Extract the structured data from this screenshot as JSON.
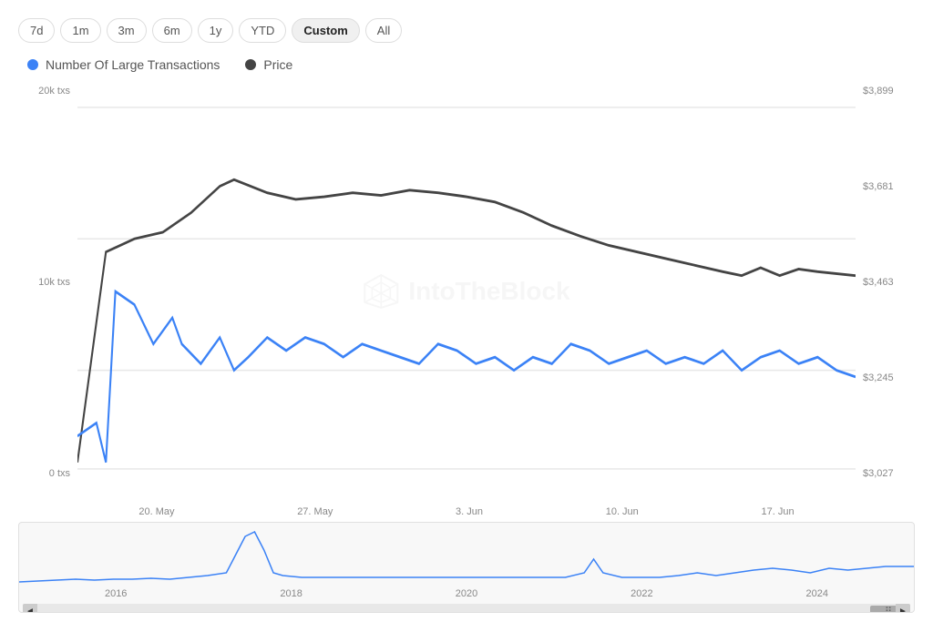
{
  "timeButtons": [
    {
      "label": "7d",
      "active": false
    },
    {
      "label": "1m",
      "active": false
    },
    {
      "label": "3m",
      "active": false
    },
    {
      "label": "6m",
      "active": false
    },
    {
      "label": "1y",
      "active": false
    },
    {
      "label": "YTD",
      "active": false
    },
    {
      "label": "Custom",
      "active": true
    },
    {
      "label": "All",
      "active": false
    }
  ],
  "legend": {
    "series1": {
      "label": "Number Of Large Transactions",
      "color": "#3b82f6"
    },
    "series2": {
      "label": "Price",
      "color": "#444"
    }
  },
  "yAxisLeft": [
    "20k txs",
    "10k txs",
    "0 txs"
  ],
  "yAxisRight": [
    "$3,899",
    "$3,681",
    "$3,463",
    "$3,245",
    "$3,027"
  ],
  "xAxisLabels": [
    "20. May",
    "27. May",
    "3. Jun",
    "10. Jun",
    "17. Jun"
  ],
  "miniXAxisLabels": [
    "2016",
    "2018",
    "2020",
    "2022",
    "2024"
  ],
  "watermark": "IntoTheBlock"
}
